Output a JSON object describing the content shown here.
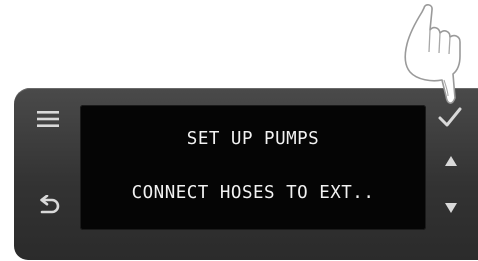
{
  "display": {
    "line1": "SET UP PUMPS",
    "line2": "CONNECT HOSES TO EXT.."
  },
  "buttons": {
    "menu": "menu-icon",
    "back": "back-arrow-icon",
    "confirm": "checkmark-icon",
    "up": "arrow-up-icon",
    "down": "arrow-down-icon"
  },
  "colors": {
    "panel": "#3a3a3a",
    "screen": "#050505",
    "text": "#f2f2f2",
    "icon": "#d9d9d9"
  }
}
